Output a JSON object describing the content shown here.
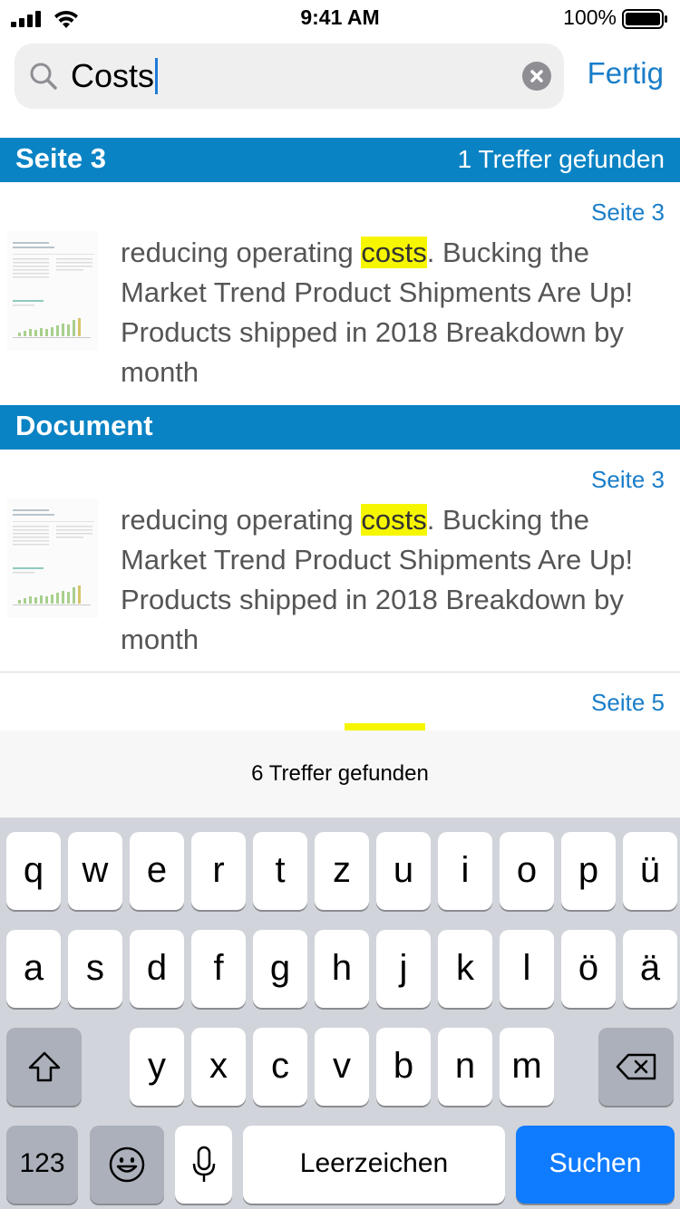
{
  "status_bar": {
    "time": "9:41 AM",
    "battery": "100%"
  },
  "search": {
    "query": "Costs",
    "done_label": "Fertig"
  },
  "sections": [
    {
      "title": "Seite 3",
      "count": "1 Treffer gefunden",
      "results": [
        {
          "page": "Seite 3",
          "before": "reducing operating ",
          "match": "costs",
          "after": ". Bucking the Market Trend Product Shipments Are Up! Products shipped in 2018 Breakdown by month"
        }
      ]
    },
    {
      "title": "Document",
      "results": [
        {
          "page": "Seite 3",
          "before": "reducing operating ",
          "match": "costs",
          "after": ". Bucking the Market Trend Product Shipments Are Up! Products shipped in 2018 Breakdown by month"
        },
        {
          "page": "Seite 5"
        }
      ]
    }
  ],
  "results_total": "6 Treffer gefunden",
  "keyboard": {
    "row1": [
      "q",
      "w",
      "e",
      "r",
      "t",
      "z",
      "u",
      "i",
      "o",
      "p",
      "ü"
    ],
    "row2": [
      "a",
      "s",
      "d",
      "f",
      "g",
      "h",
      "j",
      "k",
      "l",
      "ö",
      "ä"
    ],
    "row3": [
      "y",
      "x",
      "c",
      "v",
      "b",
      "n",
      "m"
    ],
    "numbers_label": "123",
    "space_label": "Leerzeichen",
    "search_label": "Suchen"
  },
  "colors": {
    "section_bar": "#0a83c4",
    "accent": "#1a7ec9",
    "highlight": "#f6f600",
    "search_key": "#0f7bff"
  }
}
